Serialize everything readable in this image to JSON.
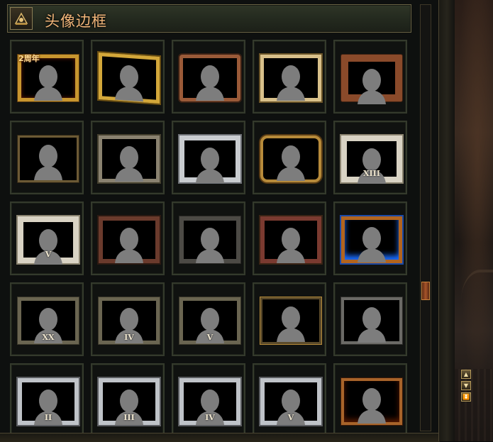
{
  "window": {
    "title": "头像边框"
  },
  "icons": {
    "header": "frame-icon",
    "scroll_up": "chevron-up-icon",
    "scroll_down": "chevron-down-icon",
    "scroll_bottom": "chevron-double-down-icon"
  },
  "frames": [
    {
      "style": "f-anniv",
      "badge": "2周年",
      "label": ""
    },
    {
      "style": "f-wing",
      "badge": "",
      "label": ""
    },
    {
      "style": "f-copper",
      "badge": "",
      "label": ""
    },
    {
      "style": "f-gold-scroll",
      "badge": "",
      "label": ""
    },
    {
      "style": "f-rust",
      "badge": "",
      "label": ""
    },
    {
      "style": "f-thin-gold",
      "badge": "",
      "label": ""
    },
    {
      "style": "f-stone",
      "badge": "",
      "label": ""
    },
    {
      "style": "f-silver-wing",
      "badge": "",
      "label": ""
    },
    {
      "style": "f-jewel",
      "badge": "",
      "label": ""
    },
    {
      "style": "f-ornate",
      "badge": "",
      "label": "XIII"
    },
    {
      "style": "f-ornate",
      "badge": "",
      "label": "V"
    },
    {
      "style": "f-red-cross",
      "badge": "",
      "label": ""
    },
    {
      "style": "f-torn",
      "badge": "",
      "label": ""
    },
    {
      "style": "f-red-drape",
      "badge": "",
      "label": ""
    },
    {
      "style": "f-blue-fire",
      "badge": "",
      "label": ""
    },
    {
      "style": "f-stone-dark",
      "badge": "",
      "label": "XX"
    },
    {
      "style": "f-stone-dark",
      "badge": "",
      "label": "IV"
    },
    {
      "style": "f-stone-dark",
      "badge": "",
      "label": "V"
    },
    {
      "style": "f-dark-gold",
      "badge": "",
      "label": ""
    },
    {
      "style": "f-slate",
      "badge": "",
      "label": ""
    },
    {
      "style": "f-silver",
      "badge": "",
      "label": "II"
    },
    {
      "style": "f-silver",
      "badge": "",
      "label": "III"
    },
    {
      "style": "f-silver",
      "badge": "",
      "label": "IV"
    },
    {
      "style": "f-silver",
      "badge": "",
      "label": "V"
    },
    {
      "style": "f-ember",
      "badge": "",
      "label": ""
    }
  ],
  "colors": {
    "title": "#f3b77a",
    "cell_border": "#343a2c",
    "scroll_thumb": "#a8542a"
  }
}
